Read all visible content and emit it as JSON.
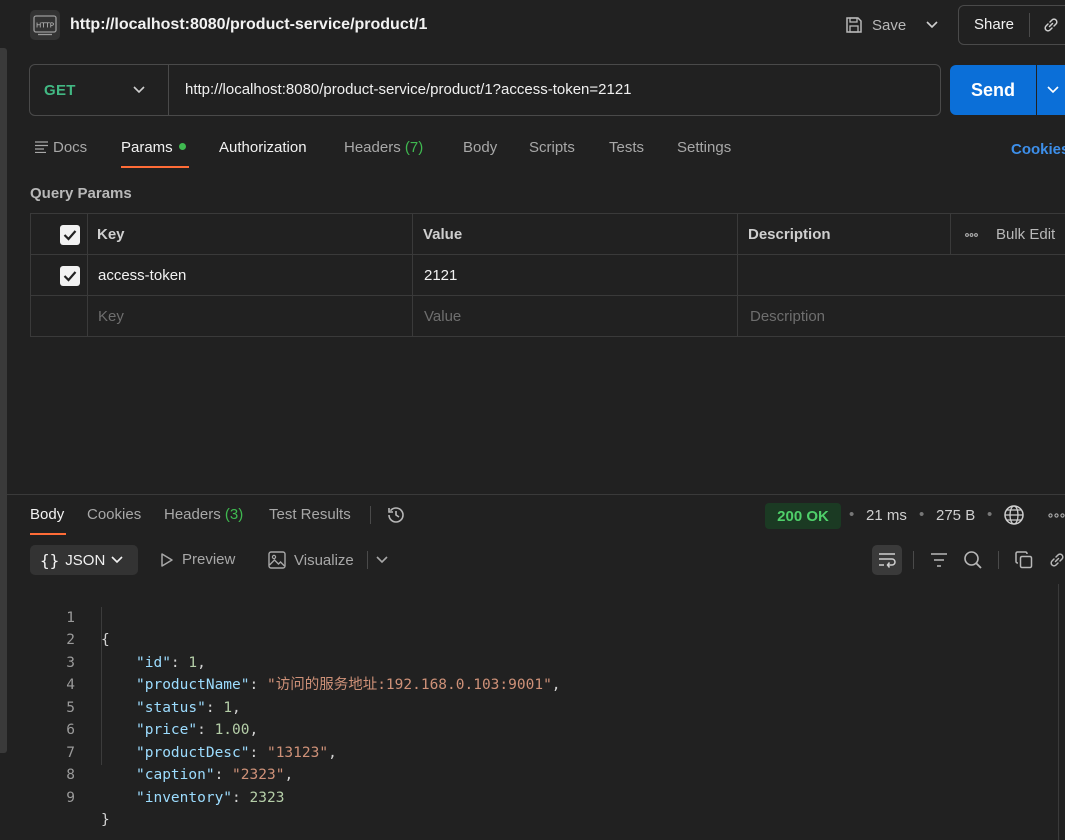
{
  "header": {
    "icon_text": "HTTP",
    "title": "http://localhost:8080/product-service/product/1",
    "save_label": "Save",
    "share_label": "Share"
  },
  "request": {
    "method": "GET",
    "url": "http://localhost:8080/product-service/product/1?access-token=2121",
    "send_label": "Send"
  },
  "tabs": {
    "docs": "Docs",
    "params": "Params",
    "authorization": "Authorization",
    "headers": "Headers",
    "headers_count": "(7)",
    "body": "Body",
    "scripts": "Scripts",
    "tests": "Tests",
    "settings": "Settings",
    "cookies": "Cookies"
  },
  "query_params": {
    "title": "Query Params",
    "columns": {
      "key": "Key",
      "value": "Value",
      "description": "Description",
      "bulk_edit": "Bulk Edit"
    },
    "rows": [
      {
        "checked": true,
        "key": "access-token",
        "value": "2121",
        "description": ""
      }
    ],
    "placeholders": {
      "key": "Key",
      "value": "Value",
      "description": "Description"
    }
  },
  "response": {
    "tabs": {
      "body": "Body",
      "cookies": "Cookies",
      "headers": "Headers",
      "headers_count": "(3)",
      "test_results": "Test Results"
    },
    "status": "200 OK",
    "time": "21 ms",
    "size": "275 B",
    "format": "JSON",
    "preview": "Preview",
    "visualize": "Visualize",
    "status_color": "#4fd06a"
  },
  "code": {
    "line_numbers": [
      "1",
      "2",
      "3",
      "4",
      "5",
      "6",
      "7",
      "8",
      "9"
    ],
    "open_brace": "{",
    "close_brace": "}",
    "fields": [
      {
        "key": "\"id\"",
        "value": "1",
        "type": "number",
        "comma": ","
      },
      {
        "key": "\"productName\"",
        "value": "\"访问的服务地址:192.168.0.103:9001\"",
        "type": "string",
        "comma": ","
      },
      {
        "key": "\"status\"",
        "value": "1",
        "type": "number",
        "comma": ","
      },
      {
        "key": "\"price\"",
        "value": "1.00",
        "type": "number",
        "comma": ","
      },
      {
        "key": "\"productDesc\"",
        "value": "\"13123\"",
        "type": "string",
        "comma": ","
      },
      {
        "key": "\"caption\"",
        "value": "\"2323\"",
        "type": "string",
        "comma": ","
      },
      {
        "key": "\"inventory\"",
        "value": "2323",
        "type": "number",
        "comma": ""
      }
    ]
  },
  "colors": {
    "accent": "#ff6c37",
    "send": "#0b6fd8",
    "method_get": "#42b883",
    "link": "#3d8fea"
  }
}
